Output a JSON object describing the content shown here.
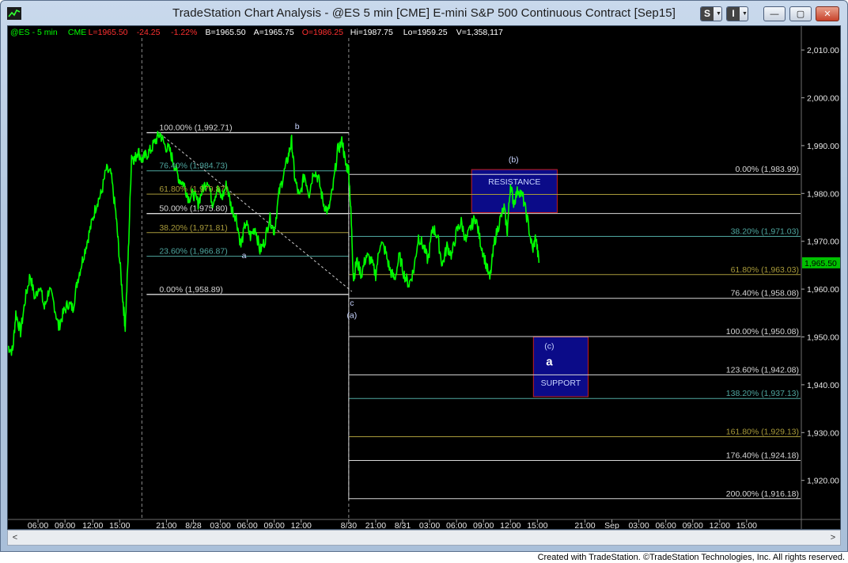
{
  "window": {
    "title": "TradeStation Chart Analysis - @ES 5 min [CME] E-mini S&P 500 Continuous Contract [Sep15]",
    "buttons": {
      "s_letter": "S",
      "i_letter": "I",
      "minimize": "—",
      "maximize": "▢",
      "close": "✕"
    }
  },
  "footer": {
    "text": "Created with TradeStation. ©TradeStation Technologies, Inc. All rights reserved."
  },
  "scrollbar": {
    "left_arrow": "<",
    "right_arrow": ">"
  },
  "colors": {
    "background": "#000000",
    "price_line": "#00ff00",
    "fib_white": "#d8d8d8",
    "fib_teal": "#4fa7a0",
    "fib_olive": "#a89a3a",
    "box_fill": "#0b0b88",
    "box_border": "#c41e1e",
    "price_marker": "#00c000"
  },
  "chart_data": {
    "type": "line",
    "header": [
      {
        "text": "@ES - 5 min",
        "color": "#00ff00"
      },
      {
        "text": "CME",
        "color": "#00ff00"
      },
      {
        "text": "L=1965.50",
        "color": "#ff3030"
      },
      {
        "text": "-24.25",
        "color": "#ff3030"
      },
      {
        "text": "-1.22%",
        "color": "#ff3030"
      },
      {
        "text": "B=1965.50",
        "color": "#ffffff"
      },
      {
        "text": "A=1965.75",
        "color": "#ffffff"
      },
      {
        "text": "O=1986.25",
        "color": "#ff3030"
      },
      {
        "text": "Hi=1987.75",
        "color": "#ffffff"
      },
      {
        "text": "Lo=1959.25",
        "color": "#ffffff"
      },
      {
        "text": "V=1,358,117",
        "color": "#ffffff"
      }
    ],
    "ylim": [
      1912,
      2013
    ],
    "xlim": [
      0,
      100
    ],
    "y_ticks": [
      {
        "value": 2010,
        "label": "2,010.00"
      },
      {
        "value": 2000,
        "label": "2,000.00"
      },
      {
        "value": 1990,
        "label": "1,990.00"
      },
      {
        "value": 1980,
        "label": "1,980.00"
      },
      {
        "value": 1970,
        "label": "1,970.00"
      },
      {
        "value": 1960,
        "label": "1,960.00"
      },
      {
        "value": 1950,
        "label": "1,950.00"
      },
      {
        "value": 1940,
        "label": "1,940.00"
      },
      {
        "value": 1930,
        "label": "1,930.00"
      },
      {
        "value": 1920,
        "label": "1,920.00"
      }
    ],
    "x_ticks": [
      {
        "x": 3.8,
        "label": "06:00"
      },
      {
        "x": 7.2,
        "label": "09:00"
      },
      {
        "x": 10.7,
        "label": "12:00"
      },
      {
        "x": 14.1,
        "label": "15:00"
      },
      {
        "x": 20.0,
        "label": "21:00"
      },
      {
        "x": 23.4,
        "label": "8/28"
      },
      {
        "x": 26.8,
        "label": "03:00"
      },
      {
        "x": 30.2,
        "label": "06:00"
      },
      {
        "x": 33.6,
        "label": "09:00"
      },
      {
        "x": 37.0,
        "label": "12:00"
      },
      {
        "x": 43.0,
        "label": "8/30"
      },
      {
        "x": 46.4,
        "label": "21:00"
      },
      {
        "x": 49.8,
        "label": "8/31"
      },
      {
        "x": 53.2,
        "label": "03:00"
      },
      {
        "x": 56.6,
        "label": "06:00"
      },
      {
        "x": 60.0,
        "label": "09:00"
      },
      {
        "x": 63.4,
        "label": "12:00"
      },
      {
        "x": 66.8,
        "label": "15:00"
      },
      {
        "x": 72.8,
        "label": "21:00"
      },
      {
        "x": 76.2,
        "label": "Sep"
      },
      {
        "x": 79.6,
        "label": "03:00"
      },
      {
        "x": 83.0,
        "label": "06:00"
      },
      {
        "x": 86.4,
        "label": "09:00"
      },
      {
        "x": 89.8,
        "label": "12:00"
      },
      {
        "x": 93.2,
        "label": "15:00"
      }
    ],
    "session_lines_x": [
      16.9,
      43.0
    ],
    "last_price": {
      "value": 1965.5,
      "label": "1,965.50"
    },
    "price_series": [
      [
        0.0,
        1948
      ],
      [
        0.6,
        1947
      ],
      [
        1.0,
        1955
      ],
      [
        1.6,
        1951
      ],
      [
        2.2,
        1958
      ],
      [
        2.8,
        1963
      ],
      [
        3.4,
        1958
      ],
      [
        4.0,
        1961
      ],
      [
        4.6,
        1956
      ],
      [
        5.2,
        1960
      ],
      [
        5.8,
        1957
      ],
      [
        6.4,
        1952
      ],
      [
        7.0,
        1955
      ],
      [
        7.6,
        1957
      ],
      [
        8.2,
        1956
      ],
      [
        8.8,
        1962
      ],
      [
        9.4,
        1966
      ],
      [
        10.0,
        1970
      ],
      [
        10.6,
        1974
      ],
      [
        11.2,
        1978
      ],
      [
        11.8,
        1980
      ],
      [
        12.4,
        1985
      ],
      [
        13.0,
        1984
      ],
      [
        13.6,
        1976
      ],
      [
        14.0,
        1968
      ],
      [
        14.5,
        1958
      ],
      [
        14.8,
        1952
      ],
      [
        15.2,
        1968
      ],
      [
        15.6,
        1988
      ],
      [
        16.0,
        1987
      ],
      [
        16.4,
        1989
      ],
      [
        16.9,
        1987
      ],
      [
        17.4,
        1988
      ],
      [
        18.0,
        1989
      ],
      [
        18.6,
        1991
      ],
      [
        19.2,
        1992.5
      ],
      [
        19.8,
        1990
      ],
      [
        20.4,
        1989
      ],
      [
        21.0,
        1986
      ],
      [
        21.6,
        1983
      ],
      [
        22.2,
        1982
      ],
      [
        22.8,
        1979
      ],
      [
        23.4,
        1980
      ],
      [
        24.0,
        1978
      ],
      [
        24.6,
        1981
      ],
      [
        25.2,
        1983
      ],
      [
        25.8,
        1978
      ],
      [
        26.4,
        1981
      ],
      [
        27.0,
        1979
      ],
      [
        27.6,
        1982
      ],
      [
        28.2,
        1977
      ],
      [
        28.8,
        1975
      ],
      [
        29.4,
        1969
      ],
      [
        30.0,
        1974
      ],
      [
        30.6,
        1971
      ],
      [
        31.2,
        1973
      ],
      [
        31.8,
        1968
      ],
      [
        32.4,
        1970
      ],
      [
        33.0,
        1975
      ],
      [
        33.6,
        1972
      ],
      [
        34.2,
        1980
      ],
      [
        34.8,
        1984
      ],
      [
        35.4,
        1988
      ],
      [
        35.8,
        1991
      ],
      [
        36.2,
        1983
      ],
      [
        36.8,
        1979
      ],
      [
        37.4,
        1984
      ],
      [
        38.0,
        1980
      ],
      [
        38.6,
        1985
      ],
      [
        39.2,
        1983
      ],
      [
        39.8,
        1978
      ],
      [
        40.4,
        1976
      ],
      [
        41.0,
        1981
      ],
      [
        41.6,
        1989
      ],
      [
        42.2,
        1991
      ],
      [
        42.6,
        1986
      ],
      [
        43.0,
        1985
      ],
      [
        43.3,
        1975
      ],
      [
        43.6,
        1962
      ],
      [
        44.0,
        1966
      ],
      [
        44.6,
        1963
      ],
      [
        45.2,
        1967
      ],
      [
        45.8,
        1966
      ],
      [
        46.4,
        1963
      ],
      [
        47.0,
        1970
      ],
      [
        47.6,
        1968
      ],
      [
        48.2,
        1964
      ],
      [
        48.8,
        1962
      ],
      [
        49.4,
        1967
      ],
      [
        50.0,
        1963
      ],
      [
        50.6,
        1961
      ],
      [
        51.2,
        1964
      ],
      [
        51.8,
        1971
      ],
      [
        52.4,
        1969
      ],
      [
        53.0,
        1966
      ],
      [
        53.6,
        1973
      ],
      [
        54.2,
        1971
      ],
      [
        54.8,
        1965
      ],
      [
        55.4,
        1969
      ],
      [
        56.0,
        1967
      ],
      [
        56.6,
        1972
      ],
      [
        57.2,
        1974
      ],
      [
        57.8,
        1970
      ],
      [
        58.4,
        1973
      ],
      [
        59.0,
        1975
      ],
      [
        59.6,
        1970
      ],
      [
        60.2,
        1966
      ],
      [
        60.8,
        1962
      ],
      [
        61.4,
        1970
      ],
      [
        62.0,
        1974
      ],
      [
        62.6,
        1977
      ],
      [
        63.0,
        1972
      ],
      [
        63.4,
        1982
      ],
      [
        63.8,
        1978
      ],
      [
        64.4,
        1981
      ],
      [
        65.0,
        1979
      ],
      [
        65.6,
        1974
      ],
      [
        66.2,
        1968
      ],
      [
        66.6,
        1971
      ],
      [
        67.0,
        1965.5
      ]
    ],
    "fib_left": {
      "x_start": 17.5,
      "x_end": 43.0,
      "levels": [
        {
          "value": 1992.71,
          "label": "100.00% (1,992.71)",
          "style": "white"
        },
        {
          "value": 1984.73,
          "label": "76.40% (1,984.73)",
          "style": "teal"
        },
        {
          "value": 1979.87,
          "label": "61.80% (1,979.87)",
          "style": "olive"
        },
        {
          "value": 1975.8,
          "label": "50.00% (1,975.80)",
          "style": "white"
        },
        {
          "value": 1971.81,
          "label": "38.20% (1,971.81)",
          "style": "olive"
        },
        {
          "value": 1966.87,
          "label": "23.60% (1,966.87)",
          "style": "teal"
        },
        {
          "value": 1958.89,
          "label": "0.00% (1,958.89)",
          "style": "white"
        }
      ]
    },
    "fib_right": {
      "x_start": 43.0,
      "x_end": 100,
      "levels": [
        {
          "value": 1983.99,
          "label": "0.00% (1,983.99)",
          "style": "white"
        },
        {
          "value": 1979.8,
          "label": "",
          "style": "olive"
        },
        {
          "value": 1975.8,
          "label": "",
          "style": "white"
        },
        {
          "value": 1971.03,
          "label": "38.20% (1,971.03)",
          "style": "teal"
        },
        {
          "value": 1963.03,
          "label": "61.80% (1,963.03)",
          "style": "olive"
        },
        {
          "value": 1958.08,
          "label": "76.40% (1,958.08)",
          "style": "white"
        },
        {
          "value": 1950.08,
          "label": "100.00% (1,950.08)",
          "style": "white"
        },
        {
          "value": 1942.08,
          "label": "123.60% (1,942.08)",
          "style": "white"
        },
        {
          "value": 1937.13,
          "label": "138.20% (1,937.13)",
          "style": "teal"
        },
        {
          "value": 1929.13,
          "label": "161.80% (1,929.13)",
          "style": "olive"
        },
        {
          "value": 1924.18,
          "label": "176.40% (1,924.18)",
          "style": "white"
        },
        {
          "value": 1916.18,
          "label": "200.00% (1,916.18)",
          "style": "white"
        }
      ]
    },
    "diagonal": {
      "from": [
        19.2,
        1992.5
      ],
      "to": [
        43.4,
        1959.5
      ]
    },
    "boxes": [
      {
        "label": "RESISTANCE",
        "x0": 58.5,
        "x1": 69.3,
        "y0": 1985,
        "y1": 1976
      },
      {
        "label": "SUPPORT",
        "x0": 66.3,
        "x1": 73.2,
        "y0": 1950,
        "y1": 1937.5
      }
    ],
    "wave_labels": [
      {
        "text": "b",
        "x": 36.5,
        "value": 1993.5,
        "bold": false
      },
      {
        "text": "a",
        "x": 29.8,
        "value": 1966.5,
        "bold": false
      },
      {
        "text": "c",
        "x": 43.4,
        "value": 1956.5,
        "bold": false
      },
      {
        "text": "(a)",
        "x": 43.4,
        "value": 1954,
        "bold": false
      },
      {
        "text": "(b)",
        "x": 63.8,
        "value": 1986.5,
        "bold": false
      },
      {
        "text": "(c)",
        "x": 68.3,
        "value": 1947.5,
        "bold": false
      },
      {
        "text": "a",
        "x": 68.3,
        "value": 1944,
        "bold": true
      }
    ]
  }
}
